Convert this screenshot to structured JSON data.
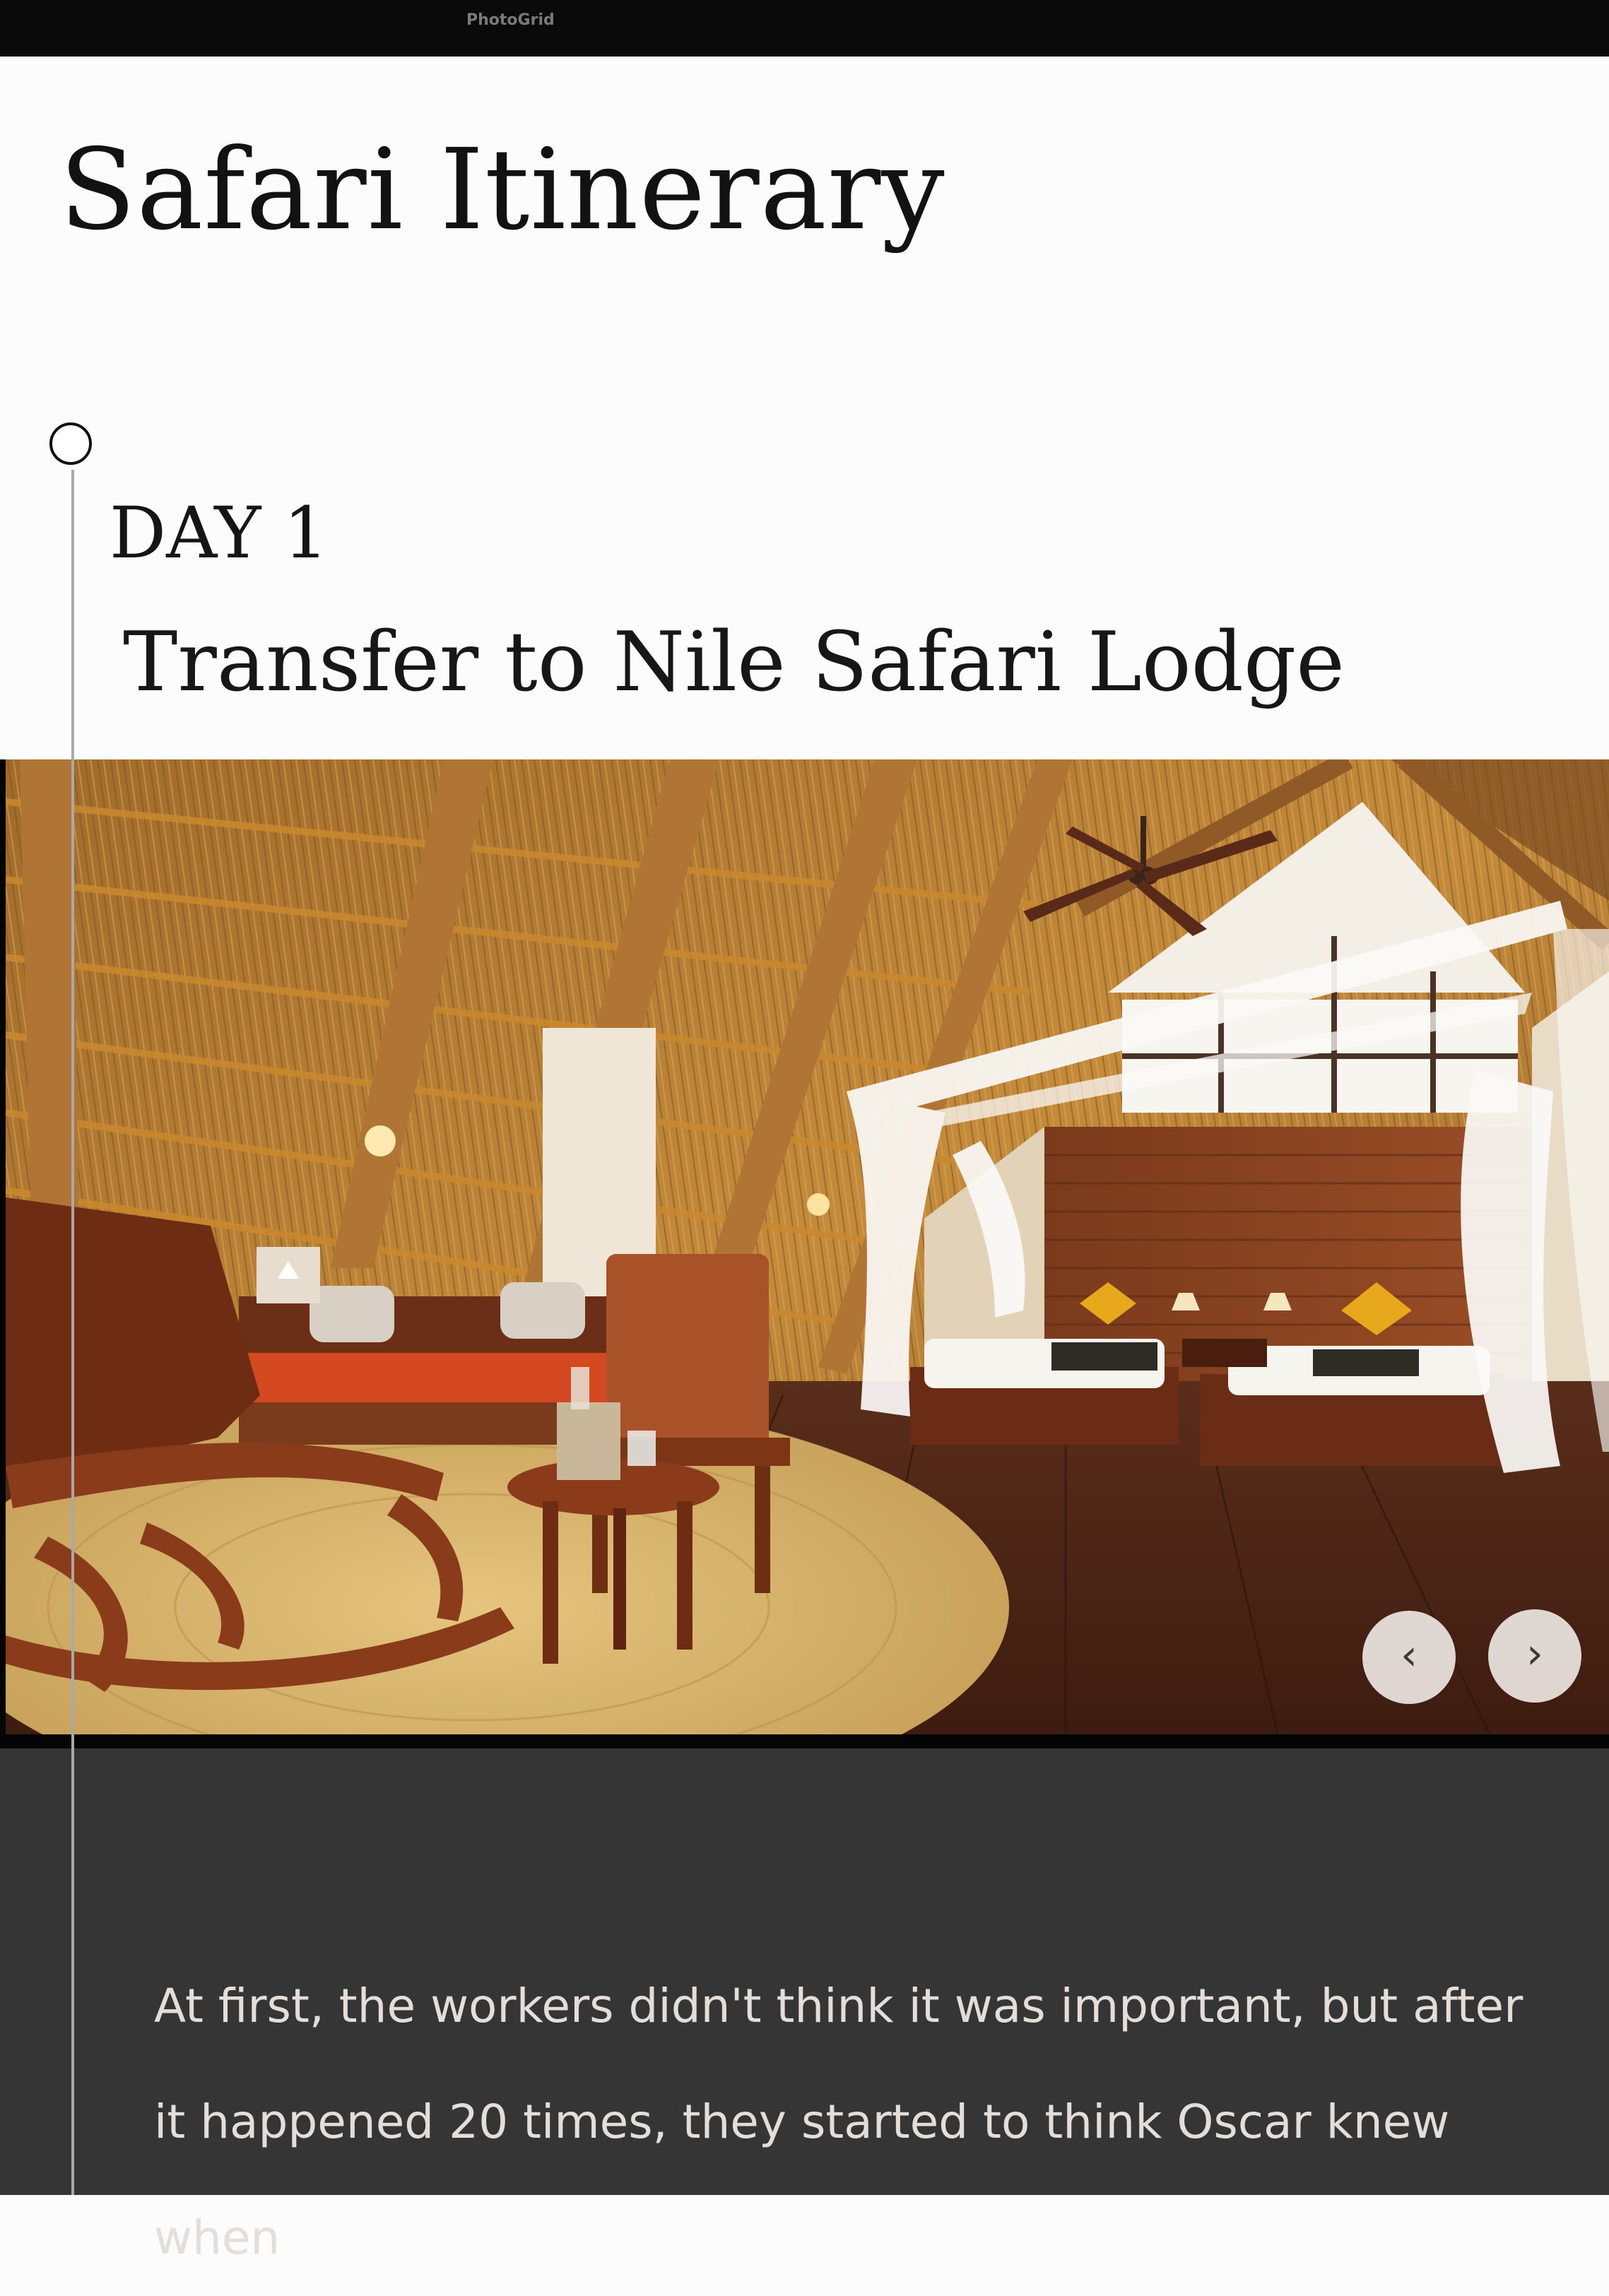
{
  "watermark": "PhotoGrid",
  "page": {
    "title": "Safari Itinerary"
  },
  "itinerary": {
    "day_label": "DAY 1",
    "day_title": "Transfer to Nile Safari Lodge",
    "photo_alt": "Nile Safari Lodge interior",
    "carousel": {
      "prev_icon": "chevron-left-icon",
      "next_icon": "chevron-right-icon",
      "prev_glyph": "‹",
      "next_glyph": "›"
    },
    "description": "At first, the workers didn't think it was important, but after it happened 20 times, they started to think Oscar knew when"
  },
  "colors": {
    "top_bar": "#0a0a0a",
    "page_background": "#fdfcfc",
    "dark_section": "#363535",
    "timeline": "#a9a9a9",
    "body_text": "#e4dedb"
  }
}
